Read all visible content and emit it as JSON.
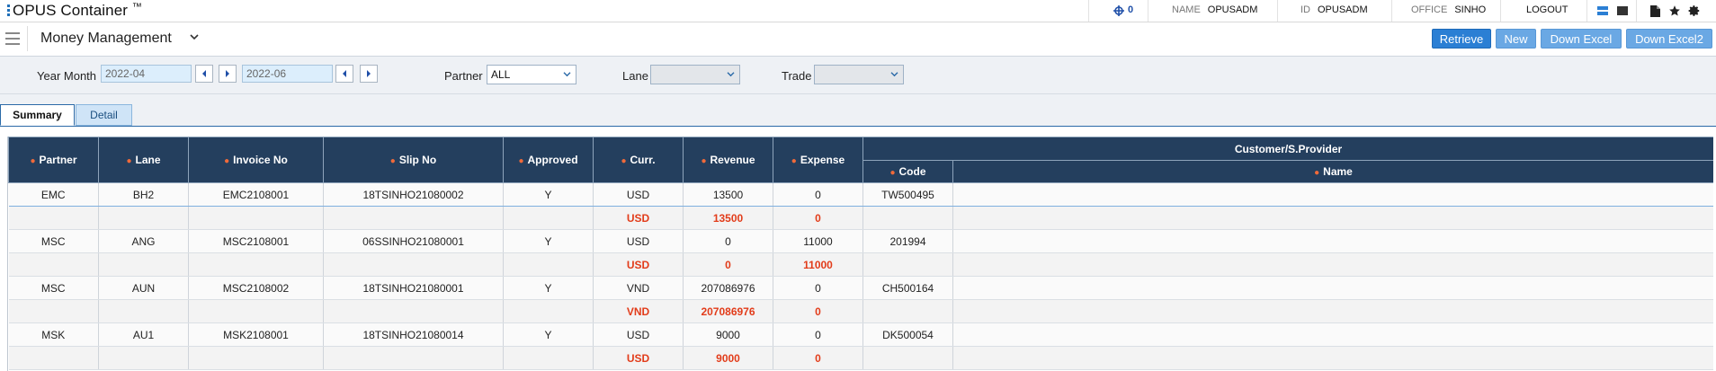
{
  "app": {
    "title": "OPUS Container",
    "tm": "™"
  },
  "topbar": {
    "msg_count": "0",
    "name_label": "NAME",
    "name_value": "OPUSADM",
    "id_label": "ID",
    "id_value": "OPUSADM",
    "office_label": "OFFICE",
    "office_value": "SINHO",
    "logout": "LOGOUT",
    "icons": [
      "network-icon",
      "list-view-icon",
      "square-view-icon",
      "document-icon",
      "star-icon",
      "gear-icon"
    ]
  },
  "menu": {
    "page_title": "Money Management",
    "buttons": {
      "retrieve": "Retrieve",
      "new": "New",
      "down_excel": "Down Excel",
      "down_excel2": "Down Excel2"
    }
  },
  "filters": {
    "year_month_label": "Year Month",
    "from": "2022-04",
    "to": "2022-06",
    "partner_label": "Partner",
    "partner_value": "ALL",
    "lane_label": "Lane",
    "lane_value": "",
    "trade_label": "Trade",
    "trade_value": ""
  },
  "tabs": {
    "summary": "Summary",
    "detail": "Detail"
  },
  "grid": {
    "headers": {
      "partner": "Partner",
      "lane": "Lane",
      "invoice_no": "Invoice No",
      "slip_no": "Slip No",
      "approved": "Approved",
      "curr": "Curr.",
      "revenue": "Revenue",
      "expense": "Expense",
      "customer_group": "Customer/S.Provider",
      "code": "Code",
      "name": "Name"
    },
    "rows": [
      {
        "main": {
          "partner": "EMC",
          "lane": "BH2",
          "invoice": "EMC2108001",
          "slip": "18TSINHO21080002",
          "approved": "Y",
          "curr": "USD",
          "revenue": "13500",
          "expense": "0",
          "code": "TW500495",
          "name": ""
        },
        "sub": {
          "curr": "USD",
          "revenue": "13500",
          "expense": "0"
        }
      },
      {
        "main": {
          "partner": "MSC",
          "lane": "ANG",
          "invoice": "MSC2108001",
          "slip": "06SSINHO21080001",
          "approved": "Y",
          "curr": "USD",
          "revenue": "0",
          "expense": "11000",
          "code": "201994",
          "name": ""
        },
        "sub": {
          "curr": "USD",
          "revenue": "0",
          "expense": "11000"
        }
      },
      {
        "main": {
          "partner": "MSC",
          "lane": "AUN",
          "invoice": "MSC2108002",
          "slip": "18TSINHO21080001",
          "approved": "Y",
          "curr": "VND",
          "revenue": "207086976",
          "expense": "0",
          "code": "CH500164",
          "name": ""
        },
        "sub": {
          "curr": "VND",
          "revenue": "207086976",
          "expense": "0"
        }
      },
      {
        "main": {
          "partner": "MSK",
          "lane": "AU1",
          "invoice": "MSK2108001",
          "slip": "18TSINHO21080014",
          "approved": "Y",
          "curr": "USD",
          "revenue": "9000",
          "expense": "0",
          "code": "DK500054",
          "name": ""
        },
        "sub": {
          "curr": "USD",
          "revenue": "9000",
          "expense": "0"
        }
      }
    ]
  },
  "colors": {
    "header_bg": "#243f5e",
    "accent": "#2b7fd4",
    "required_dot": "#f06a3a",
    "subtotal_text": "#e23c1a"
  }
}
